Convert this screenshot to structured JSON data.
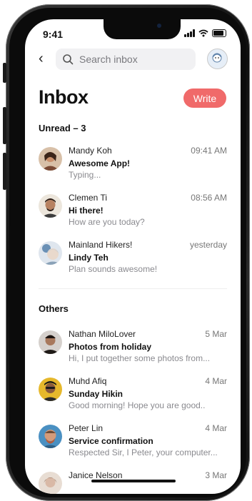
{
  "status_bar": {
    "time": "9:41"
  },
  "header": {
    "search_placeholder": "Search inbox"
  },
  "title": "Inbox",
  "write_label": "Write",
  "sections": {
    "unread_heading": "Unread – 3",
    "others_heading": "Others"
  },
  "unread": [
    {
      "name": "Mandy Koh",
      "time": "09:41 AM",
      "subject": "Awesome App!",
      "preview": "Typing...",
      "avatar_color": "#c98f6b"
    },
    {
      "name": "Clemen Ti",
      "time": "08:56 AM",
      "subject": "Hi there!",
      "preview": "How are you today?",
      "avatar_color": "#6b4b3a"
    },
    {
      "name": "Mainland Hikers!",
      "time": "yesterday",
      "subject": "Lindy Teh",
      "preview": "Plan sounds awesome!",
      "avatar_color": "#b9c3cf"
    }
  ],
  "others": [
    {
      "name": "Nathan MiloLover",
      "time": "5 Mar",
      "subject": "Photos from holiday",
      "preview": "Hi, I put together some photos from...",
      "avatar_color": "#3b2b24"
    },
    {
      "name": "Muhd Afiq",
      "time": "4 Mar",
      "subject": "Sunday Hikin",
      "preview": "Good morning! Hope you are good..",
      "avatar_color": "#e2b62a"
    },
    {
      "name": "Peter Lin",
      "time": "4 Mar",
      "subject": "Service confirmation",
      "preview": "Respected Sir, I Peter, your computer...",
      "avatar_color": "#4a90c2"
    },
    {
      "name": "Janice Nelson",
      "time": "3 Mar",
      "subject": "",
      "preview": "",
      "avatar_color": "#d9b9a6"
    }
  ],
  "colors": {
    "accent": "#f06a6a",
    "text": "#111111",
    "muted": "#8a8a8f"
  }
}
